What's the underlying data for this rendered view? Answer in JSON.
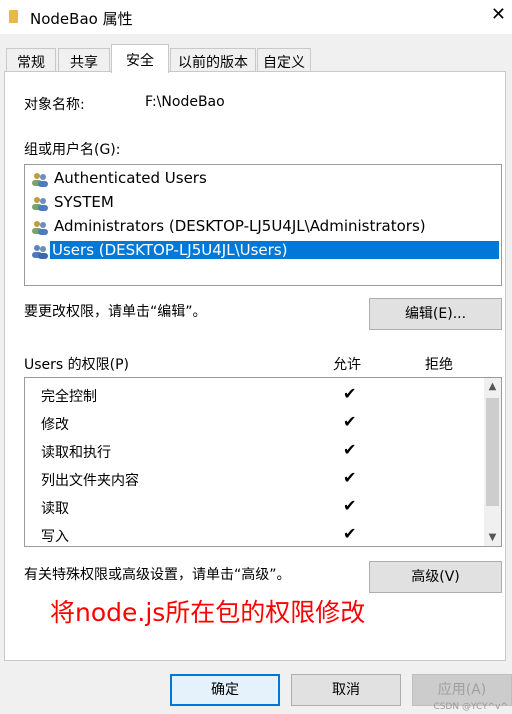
{
  "window": {
    "title": "NodeBao 属性"
  },
  "tabs": [
    {
      "label": "常规"
    },
    {
      "label": "共享"
    },
    {
      "label": "安全"
    },
    {
      "label": "以前的版本"
    },
    {
      "label": "自定义"
    }
  ],
  "security": {
    "object_name_label": "对象名称:",
    "object_name_value": "F:\\NodeBao",
    "groups_label": "组或用户名(G):",
    "users": [
      {
        "name": "Authenticated Users",
        "selected": false
      },
      {
        "name": "SYSTEM",
        "selected": false
      },
      {
        "name": "Administrators (DESKTOP-LJ5U4JL\\Administrators)",
        "selected": false
      },
      {
        "name": "Users (DESKTOP-LJ5U4JL\\Users)",
        "selected": true
      }
    ],
    "change_hint": "要更改权限，请单击“编辑”。",
    "edit_button": "编辑(E)...",
    "perm_title": "Users 的权限(P)",
    "allow_header": "允许",
    "deny_header": "拒绝",
    "permissions": [
      {
        "name": "完全控制",
        "allow": "✔",
        "deny": ""
      },
      {
        "name": "修改",
        "allow": "✔",
        "deny": ""
      },
      {
        "name": "读取和执行",
        "allow": "✔",
        "deny": ""
      },
      {
        "name": "列出文件夹内容",
        "allow": "✔",
        "deny": ""
      },
      {
        "name": "读取",
        "allow": "✔",
        "deny": ""
      },
      {
        "name": "写入",
        "allow": "✔",
        "deny": ""
      }
    ],
    "advanced_hint": "有关特殊权限或高级设置，请单击“高级”。",
    "advanced_button": "高级(V)"
  },
  "annotation": "将node.js所在包的权限修改",
  "footer": {
    "ok": "确定",
    "cancel": "取消",
    "apply": "应用(A)"
  },
  "watermark": "CSDN @YCY^v^"
}
